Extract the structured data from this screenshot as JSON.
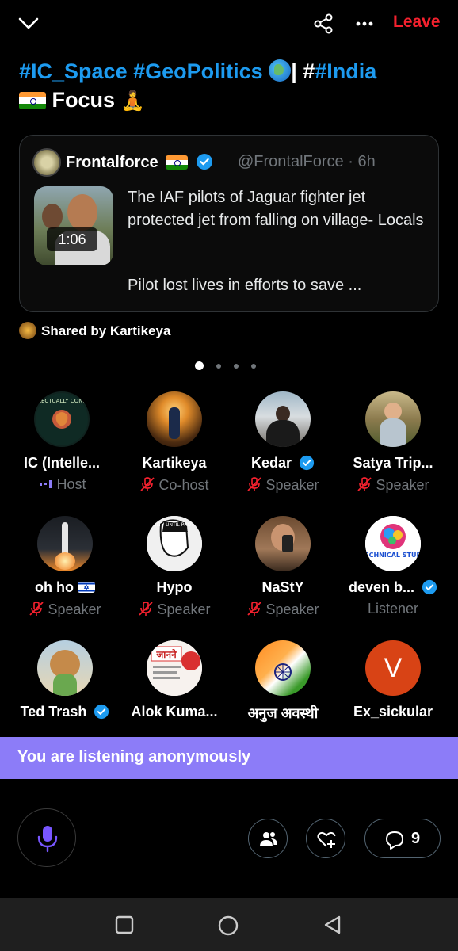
{
  "topbar": {
    "leave_label": "Leave"
  },
  "space": {
    "title_tag1": "#IC_Space",
    "title_tag2": "#GeoPolitics",
    "title_sep": "| #",
    "title_tag3": "#India",
    "title_focus": "Focus"
  },
  "post": {
    "author": "Frontalforce",
    "handle": "@FrontalForce · 6h",
    "duration": "1:06",
    "text": "The IAF pilots of Jaguar fighter jet protected jet from falling on village- Locals",
    "text2": "Pilot lost lives in efforts to save ..."
  },
  "shared_by": "Shared by Kartikeya",
  "participants": [
    {
      "name": "IC (Intelle...",
      "role": "Host"
    },
    {
      "name": "Kartikeya",
      "role": "Co-host"
    },
    {
      "name": "Kedar",
      "role": "Speaker"
    },
    {
      "name": "Satya Trip...",
      "role": "Speaker"
    },
    {
      "name": "oh ho",
      "role": "Speaker"
    },
    {
      "name": "Hypo",
      "role": "Speaker"
    },
    {
      "name": "NaStY",
      "role": "Speaker"
    },
    {
      "name": "deven b...",
      "role": "Listener"
    },
    {
      "name": "Ted Trash",
      "role": ""
    },
    {
      "name": "Alok Kuma...",
      "role": ""
    },
    {
      "name": "अनुज अवस्थी",
      "role": ""
    },
    {
      "name": "Ex_sickular",
      "role": ""
    }
  ],
  "avatar_texts": {
    "ic": "INTELLECTUALLY CONFUSED",
    "hypo": "GUILTY UNTIL PROVEN",
    "deven": "TECHNICAL STUDY",
    "alok": "जानने",
    "ex": "V"
  },
  "banner": "You are listening anonymously",
  "controls": {
    "comment_count": "9"
  },
  "colors": {
    "accent": "#1d9bf0",
    "leave": "#f4212e",
    "banner": "#8c7cf8",
    "mic": "#7856ff"
  }
}
